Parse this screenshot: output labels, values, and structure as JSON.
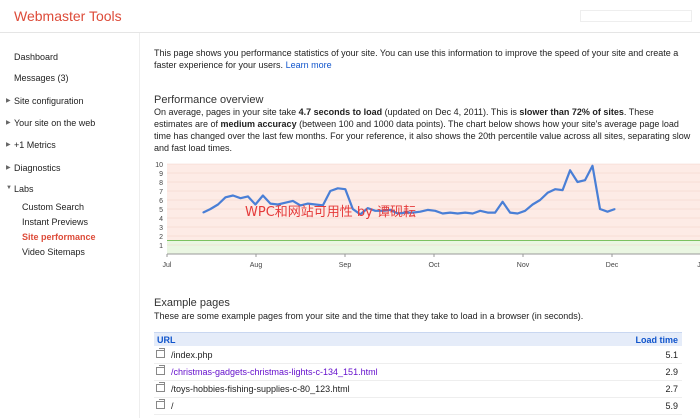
{
  "header": {
    "brand": "Webmaster Tools",
    "faded_box_text": ""
  },
  "sidebar": {
    "dashboard": "Dashboard",
    "messages": "Messages (3)",
    "site_configuration": "Site configuration",
    "your_site": "Your site on the web",
    "plus1": "+1 Metrics",
    "diagnostics": "Diagnostics",
    "labs": "Labs",
    "labs_items": [
      "Custom Search",
      "Instant Previews",
      "Site performance",
      "Video Sitemaps"
    ]
  },
  "intro": {
    "text": "This page shows you performance statistics of your site. You can use this information to improve the speed of your site and create a faster experience for your users.",
    "learn_more": "Learn more"
  },
  "overview": {
    "title": "Performance overview",
    "p1": "On average, pages in your site take ",
    "load_bold": "4.7 seconds to load",
    "p2": " (updated on Dec 4, 2011). This is ",
    "slower_bold": "slower than 72% of sites",
    "p3": ". These estimates are of ",
    "accuracy_bold": "medium accuracy",
    "p4": " (between 100 and 1000 data points). The chart below shows how your site's average page load time has changed over the last few months. For your reference, it also shows the 20th percentile value across all sites, separating slow and fast load times."
  },
  "watermark": "WPC和网站可用性 by 谭砚耘",
  "chart_data": {
    "type": "line",
    "y_ticks": [
      "10",
      "9",
      "8",
      "7",
      "6",
      "5",
      "4",
      "3",
      "2",
      "1"
    ],
    "x_ticks": [
      "Jul",
      "Aug",
      "Sep",
      "Oct",
      "Nov",
      "Dec",
      "Ja"
    ],
    "ylim": [
      0,
      10
    ],
    "threshold": 1.5,
    "series": [
      {
        "values": [
          4.6,
          5.0,
          5.5,
          6.3,
          6.5,
          6.2,
          6.4,
          5.5,
          6.5,
          5.6,
          5.5,
          5.7,
          5.9,
          5.4,
          5.6,
          5.5,
          5.4,
          7.0,
          7.3,
          7.2,
          5.0,
          4.4,
          5.1,
          4.8,
          4.8,
          4.9,
          4.5,
          4.6,
          4.6,
          4.7,
          4.9,
          4.8,
          4.5,
          4.6,
          4.5,
          4.6,
          4.5,
          4.8,
          4.6,
          4.6,
          5.8,
          4.6,
          4.5,
          4.8,
          5.5,
          6.0,
          6.8,
          7.2,
          7.1,
          9.3,
          8.0,
          8.2,
          9.8,
          5.0,
          4.7,
          5.0
        ]
      }
    ]
  },
  "examples": {
    "title": "Example pages",
    "desc": "These are some example pages from your site and the time that they take to load in a browser (in seconds).",
    "col_url": "URL",
    "col_time": "Load time",
    "rows": [
      {
        "url": "/index.php",
        "time": "5.1"
      },
      {
        "url": "/christmas-gadgets-christmas-lights-c-134_151.html",
        "time": "2.9"
      },
      {
        "url": "/toys-hobbies-fishing-supplies-c-80_123.html",
        "time": "2.7"
      },
      {
        "url": "/",
        "time": "5.9"
      }
    ]
  }
}
